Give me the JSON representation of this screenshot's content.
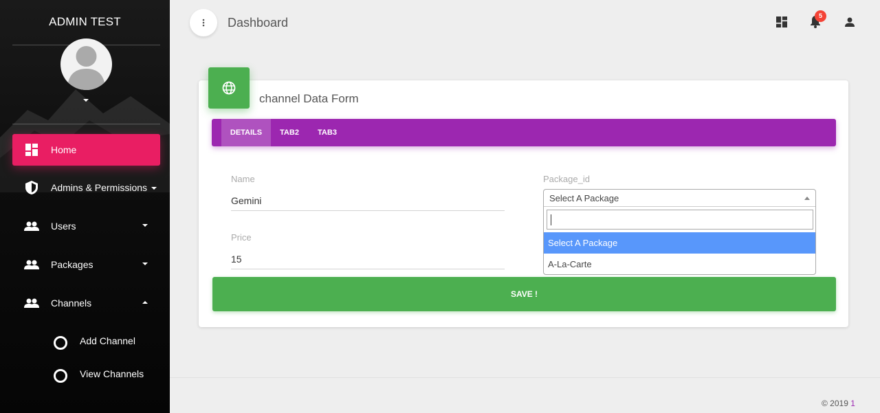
{
  "sidebar": {
    "title": "ADMIN TEST",
    "items": [
      {
        "label": "Home",
        "icon": "dashboard-icon"
      },
      {
        "label": "Admins & Permissions",
        "icon": "shield-icon"
      },
      {
        "label": "Users",
        "icon": "people-icon"
      },
      {
        "label": "Packages",
        "icon": "people-icon"
      },
      {
        "label": "Channels",
        "icon": "people-icon"
      }
    ],
    "sub_items": [
      {
        "label": "Add Channel",
        "icon": "circle-icon"
      },
      {
        "label": "View Channels",
        "icon": "circle-icon"
      }
    ]
  },
  "header": {
    "title": "Dashboard",
    "notification_count": "5"
  },
  "card": {
    "title": "channel Data Form",
    "tabs": [
      {
        "label": "DETAILS"
      },
      {
        "label": "TAB2"
      },
      {
        "label": "TAB3"
      }
    ],
    "fields": {
      "name_label": "Name",
      "name_value": "Gemini",
      "price_label": "Price",
      "price_value": "15",
      "package_label": "Package_id",
      "package_selected": "Select A Package",
      "package_options": [
        {
          "label": "Select A Package"
        },
        {
          "label": "A-La-Carte"
        }
      ]
    },
    "save_label": "SAVE !"
  },
  "footer": {
    "copyright_prefix": "© 2019",
    "copyright_suffix": "1"
  },
  "colors": {
    "accent_pink": "#e91e63",
    "tab_purple": "#9c27b0",
    "success_green": "#4caf50",
    "select_highlight": "#5897fb",
    "badge_red": "#f44336"
  }
}
